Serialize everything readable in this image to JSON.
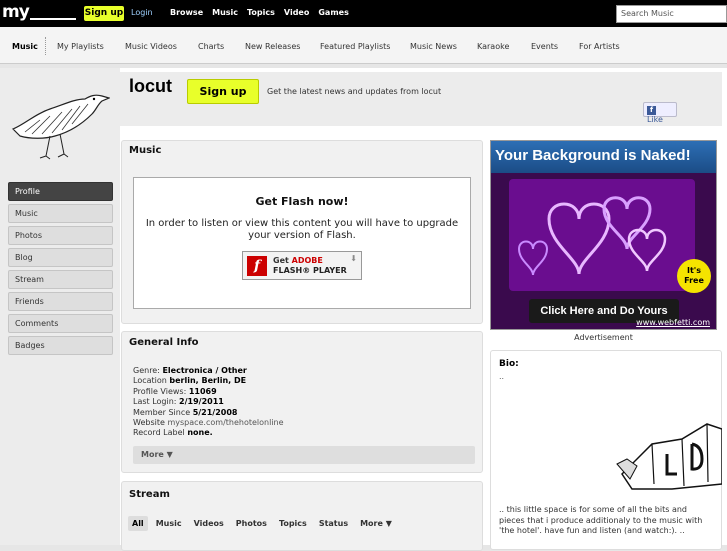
{
  "top": {
    "logo": "my",
    "signup": "Sign up",
    "login": "Login",
    "nav": [
      "Browse",
      "Music",
      "Topics",
      "Video",
      "Games"
    ],
    "search_placeholder": "Search Music"
  },
  "subnav": [
    "Music",
    "My Playlists",
    "Music Videos",
    "Charts",
    "New Releases",
    "Featured Playlists",
    "Music News",
    "Karaoke",
    "Events",
    "For Artists"
  ],
  "sidebar": [
    "Profile",
    "Music",
    "Photos",
    "Blog",
    "Stream",
    "Friends",
    "Comments",
    "Badges"
  ],
  "header": {
    "artist": "locut",
    "signup": "Sign up",
    "tagline": "Get the latest news and updates from locut",
    "like": "Like"
  },
  "music": {
    "title": "Music",
    "flash_title": "Get Flash now!",
    "flash_text": "In order to listen or view this content you will have to upgrade your version of Flash.",
    "btn_get": "Get",
    "btn_adobe": "ADOBE",
    "btn_flash": "FLASH® PLAYER"
  },
  "ad": {
    "headline": "Your Background is Naked!",
    "badge": "It's Free",
    "cta": "Click Here and Do Yours",
    "url": "www.webfetti.com",
    "label": "Advertisement"
  },
  "general_info": {
    "title": "General Info",
    "genre_label": "Genre:",
    "genre": "Electronica / Other",
    "location_label": "Location",
    "location": "berlin, Berlin, DE",
    "views_label": "Profile Views:",
    "views": "11069",
    "last_login_label": "Last Login:",
    "last_login": "2/19/2011",
    "member_since_label": "Member Since",
    "member_since": "5/21/2008",
    "website_label": "Website",
    "website": "myspace.com/thehotelonline",
    "record_label_label": "Record Label",
    "record_label": "none.",
    "more": "More ▼"
  },
  "stream": {
    "title": "Stream",
    "tabs": [
      "All",
      "Music",
      "Videos",
      "Photos",
      "Topics",
      "Status",
      "More ▼"
    ]
  },
  "bio": {
    "title": "Bio:",
    "dots": "..",
    "text": ".. this little space is for some of all the bits and pieces that i produce additionaly to the music with 'the hotel'. have fun and listen (and watch:). .."
  }
}
